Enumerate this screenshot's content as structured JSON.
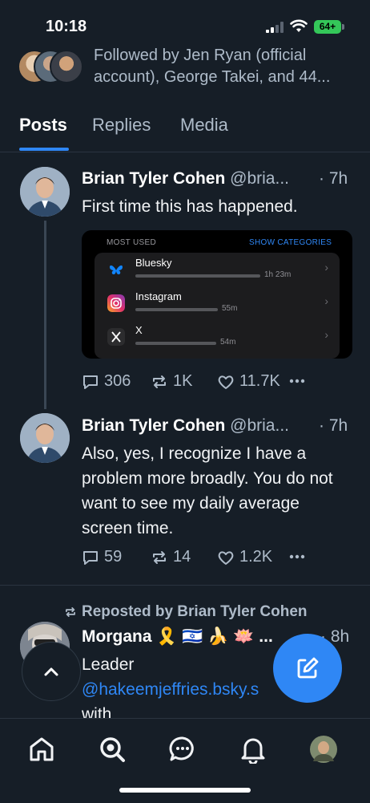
{
  "status_bar": {
    "time": "10:18",
    "battery": "64+"
  },
  "profile": {
    "followed_by": "Followed by Jen Ryan (official\naccount), George Takei, and 44..."
  },
  "tabs": [
    {
      "label": "Posts",
      "active": true
    },
    {
      "label": "Replies",
      "active": false
    },
    {
      "label": "Media",
      "active": false
    }
  ],
  "posts": [
    {
      "name": "Brian Tyler Cohen",
      "handle": "@bria...",
      "time": "· 7h",
      "text": "First time this has happened.",
      "replies": "306",
      "reposts": "1K",
      "likes": "11.7K",
      "embed": {
        "header_left": "MOST USED",
        "header_right": "SHOW CATEGORIES",
        "apps": [
          {
            "name": "Bluesky",
            "duration": "1h 23m",
            "usage_fraction": 1.0,
            "icon": "butterfly-icon"
          },
          {
            "name": "Instagram",
            "duration": "55m",
            "usage_fraction": 0.66,
            "icon": "instagram-icon"
          },
          {
            "name": "X",
            "duration": "54m",
            "usage_fraction": 0.65,
            "icon": "x-logo-icon"
          }
        ]
      }
    },
    {
      "name": "Brian Tyler Cohen",
      "handle": "@bria...",
      "time": "· 7h",
      "text": "Also, yes, I recognize I have a problem more broadly. You do not want to see my daily average screen time.",
      "replies": "59",
      "reposts": "14",
      "likes": "1.2K"
    },
    {
      "repost_label": "Reposted by Brian Tyler Cohen",
      "name": "Morgana 🎗️ 🇮🇱 🍌 🪷 ...",
      "time": "· 8h",
      "text_line1": "Leader",
      "link": "@hakeemjeffries.bsky.s",
      "text_line3": "with"
    }
  ],
  "colors": {
    "accent": "#2f87f5",
    "background": "#161e27",
    "muted": "#aebbc9"
  }
}
